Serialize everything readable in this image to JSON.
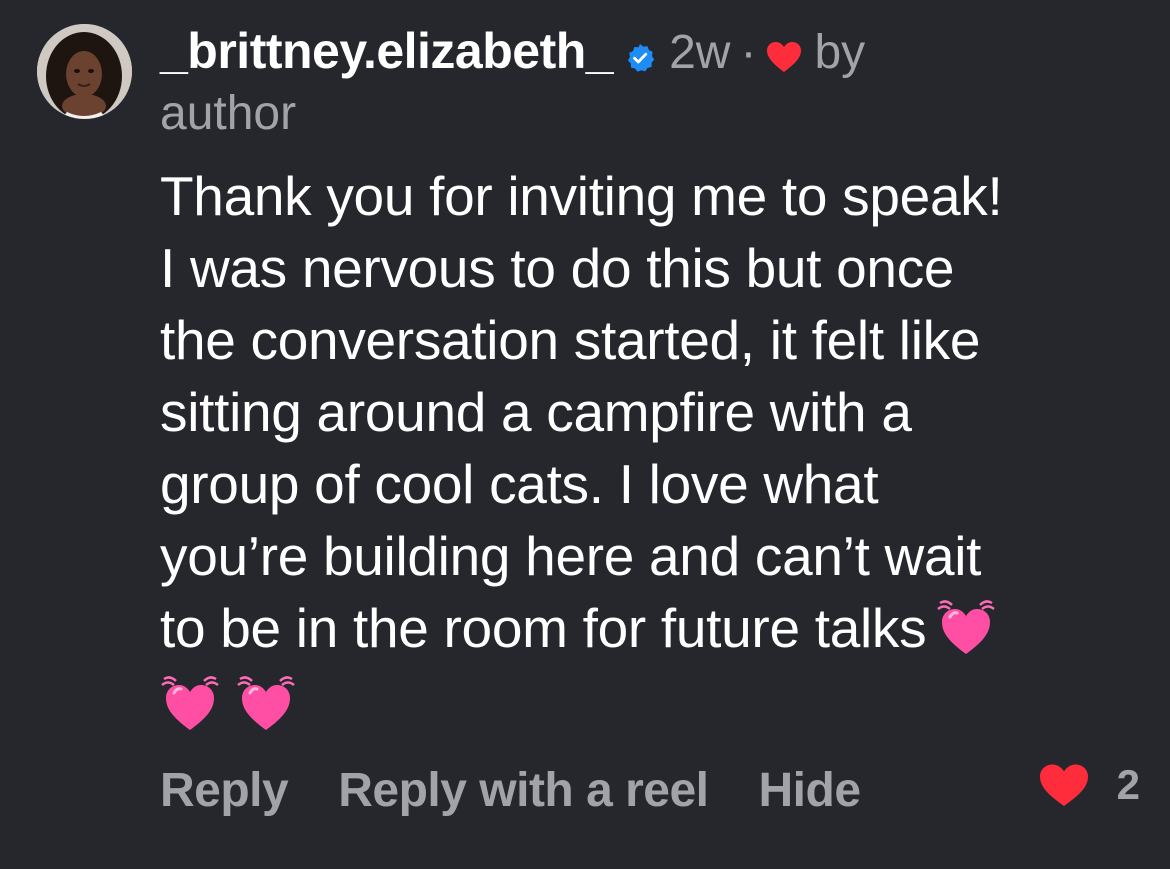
{
  "comment": {
    "username": "_brittney.elizabeth_",
    "verified_icon": "verified-badge-icon",
    "time_ago": "2w",
    "separator": "·",
    "liked_by_author_icon": "heart-icon",
    "liked_by_label": "by",
    "liked_by_who": "author",
    "text_lines": [
      "Thank you for inviting me to speak!",
      "I was nervous to do this but once",
      "the conversation started, it felt like",
      "sitting around a campfire with a",
      "group of cool cats. I love what",
      "you’re building here and can’t wait",
      "to be in the room for future talks"
    ],
    "emojis": [
      "beating-heart-icon",
      "beating-heart-icon",
      "beating-heart-icon"
    ],
    "actions": {
      "reply": "Reply",
      "reply_reel": "Reply with a reel",
      "hide": "Hide"
    },
    "likes": {
      "count": "2",
      "icon": "heart-icon"
    }
  },
  "colors": {
    "background": "#25272d",
    "primary_text": "#ffffff",
    "secondary_text": "#a1a3a9",
    "verified_blue": "#1d8cf5",
    "heart_red": "#ff2d3c",
    "emoji_pink": "#ff4fa5"
  }
}
